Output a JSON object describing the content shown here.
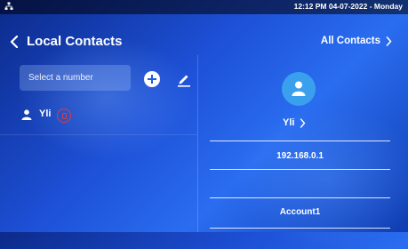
{
  "status_bar": {
    "network_icon": "network-icon",
    "time_date": "12:12 PM 04-07-2022 - Monday"
  },
  "header": {
    "back_icon": "chevron-left-icon",
    "title": "Local Contacts",
    "all_contacts_label": "All Contacts",
    "all_contacts_icon": "chevron-right-icon"
  },
  "search": {
    "placeholder": "Select a number",
    "value": ""
  },
  "toolbar": {
    "add_icon": "plus-circle-icon",
    "edit_icon": "pencil-icon"
  },
  "contacts": [
    {
      "name": "Yli",
      "icon": "person-icon"
    }
  ],
  "detail": {
    "avatar_icon": "person-icon",
    "name": "Yli",
    "ip": "192.168.0.1",
    "empty_row": "",
    "account": "Account1"
  },
  "colors": {
    "accent": "#3aa0ee",
    "annotation": "#e23a3a",
    "background": "#1d50d6"
  }
}
